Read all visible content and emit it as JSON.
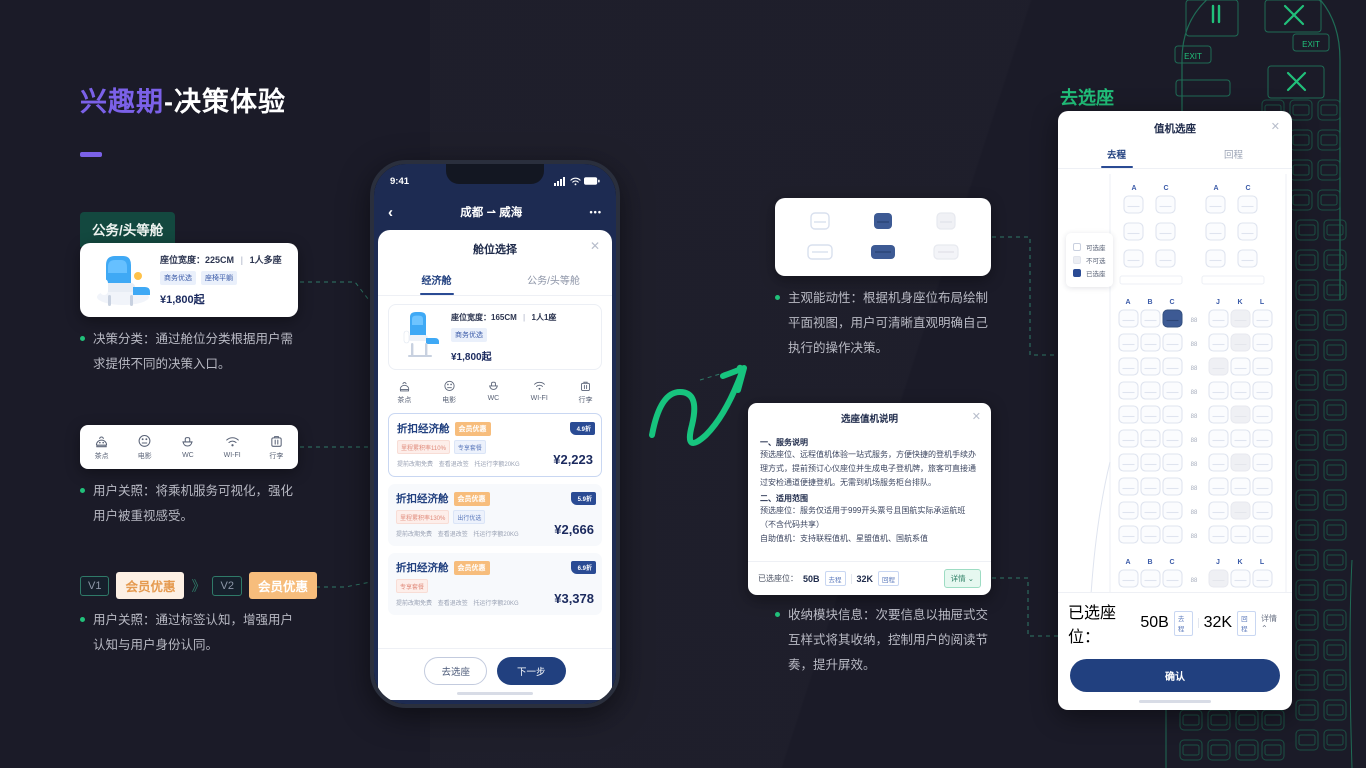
{
  "page": {
    "title_purple": "兴趣期",
    "title_white": "-决策体验"
  },
  "left": {
    "cabin_tag": "公务/头等舱",
    "cabin_card": {
      "width_label": "座位宽度：225CM",
      "seat_count": "1人多座",
      "chips": [
        "商务优选",
        "座椅平躺"
      ],
      "price": "¥1,800起"
    },
    "note1_line1": "决策分类：通过舱位分类根据用户需",
    "note1_line2": "求提供不同的决策入口。",
    "services": [
      {
        "label": "茶点",
        "icon": "snack-icon"
      },
      {
        "label": "电影",
        "icon": "movie-icon"
      },
      {
        "label": "WC",
        "icon": "wc-icon"
      },
      {
        "label": "WI-FI",
        "icon": "wifi-icon"
      },
      {
        "label": "行李",
        "icon": "luggage-icon"
      }
    ],
    "note2_line1": "用户关照：将乘机服务可视化，强化",
    "note2_line2": "用户被重视感受。",
    "version_row": {
      "v1_label": "V1",
      "v1_badge": "会员优惠",
      "chevron": "》",
      "v2_label": "V2",
      "v2_badge": "会员优惠"
    },
    "note3_line1": "用户关照：通过标签认知，增强用户",
    "note3_line2": "认知与用户身份认同。"
  },
  "phone": {
    "status_time": "9:41",
    "nav_back": "‹",
    "nav_title": "成都 ⇀ 威海",
    "nav_more": "•••",
    "sheet_title": "舱位选择",
    "close": "✕",
    "tabs": [
      {
        "label": "经济舱",
        "active": true
      },
      {
        "label": "公务/头等舱",
        "active": false
      }
    ],
    "mini_cabin": {
      "width_label": "座位宽度：165CM",
      "seat_count": "1人1座",
      "chip": "商务优选",
      "price": "¥1,800起"
    },
    "services": [
      "茶点",
      "电影",
      "WC",
      "WI-FI",
      "行李"
    ],
    "fares": [
      {
        "name": "折扣经济舱",
        "vip": "会员优惠",
        "chip1": "里程累积率110%",
        "chip2": "专享套餐",
        "sub1": "提前改期免费",
        "sub2": "查看退改签",
        "sub3": "托运行李额20KG",
        "price": "¥2,223",
        "discount": "4.9折"
      },
      {
        "name": "折扣经济舱",
        "vip": "会员优惠",
        "chip1": "里程累积率130%",
        "chip2": "出行优选",
        "sub1": "提前改期免费",
        "sub2": "查看退改签",
        "sub3": "托运行李额20KG",
        "price": "¥2,666",
        "discount": "5.9折"
      },
      {
        "name": "折扣经济舱",
        "vip": "会员优惠",
        "chip1": "专享套餐",
        "chip2": "",
        "sub1": "提前改期免费",
        "sub2": "查看退改签",
        "sub3": "托运行李额20KG",
        "price": "¥3,378",
        "discount": "6.9折"
      }
    ],
    "footer": {
      "secondary": "去选座",
      "primary": "下一步"
    }
  },
  "middle": {
    "note_seats_l1": "主观能动性：根据机身座位布局绘制",
    "note_seats_l2": "平面视图，用户可清晰直观明确自己",
    "note_seats_l3": "执行的操作决策。",
    "modal": {
      "title": "选座值机说明",
      "close": "✕",
      "h1": "一、服务说明",
      "p1": "预选座位、远程值机体验一站式服务，方便快捷的登机手续办理方式，提前预订心仪座位并生成电子登机牌，旅客可直接通过安检通道便捷登机。无需到机场服务柜台排队。",
      "h2": "二、适用范围",
      "p2": "预选座位：服务仅适用于999开头票号且国航实际承运航班（不含代码共享）",
      "p3": "自助值机：支持联程值机、星盟值机、国航系值",
      "footer_label": "已选座位：",
      "seat1": "50B",
      "seat1_tag": "去程",
      "seat2": "32K",
      "seat2_tag": "回程",
      "detail": "详情 ⌄"
    },
    "note_modal_l1": "收纳模块信息：次要信息以抽屉式交",
    "note_modal_l2": "互样式将其收纳，控制用户的阅读节",
    "note_modal_l3": "奏，提升屏效。"
  },
  "right": {
    "label": "去选座",
    "title": "值机选座",
    "close": "✕",
    "tabs": [
      {
        "label": "去程",
        "active": true
      },
      {
        "label": "回程",
        "active": false
      }
    ],
    "legend": [
      {
        "label": "可选座",
        "state": "available"
      },
      {
        "label": "不可选",
        "state": "unavailable"
      },
      {
        "label": "已选座",
        "state": "selected"
      }
    ],
    "business_cols": [
      "A",
      "C",
      "A",
      "C"
    ],
    "economy_cols": [
      "A",
      "B",
      "C",
      "J",
      "K",
      "L"
    ],
    "row_number": "88",
    "footer": {
      "label": "已选座位：",
      "seat1": "50B",
      "seat1_tag": "去程",
      "seat2": "32K",
      "seat2_tag": "回程",
      "detail": "详情 ⌃",
      "confirm": "确认"
    }
  },
  "background": {
    "exit_label": "EXIT"
  },
  "colors": {
    "bg": "#1b1b28",
    "purple": "#7b61e8",
    "green": "#21c07a",
    "navy": "#21407f",
    "orange": "#f7bd7c"
  }
}
